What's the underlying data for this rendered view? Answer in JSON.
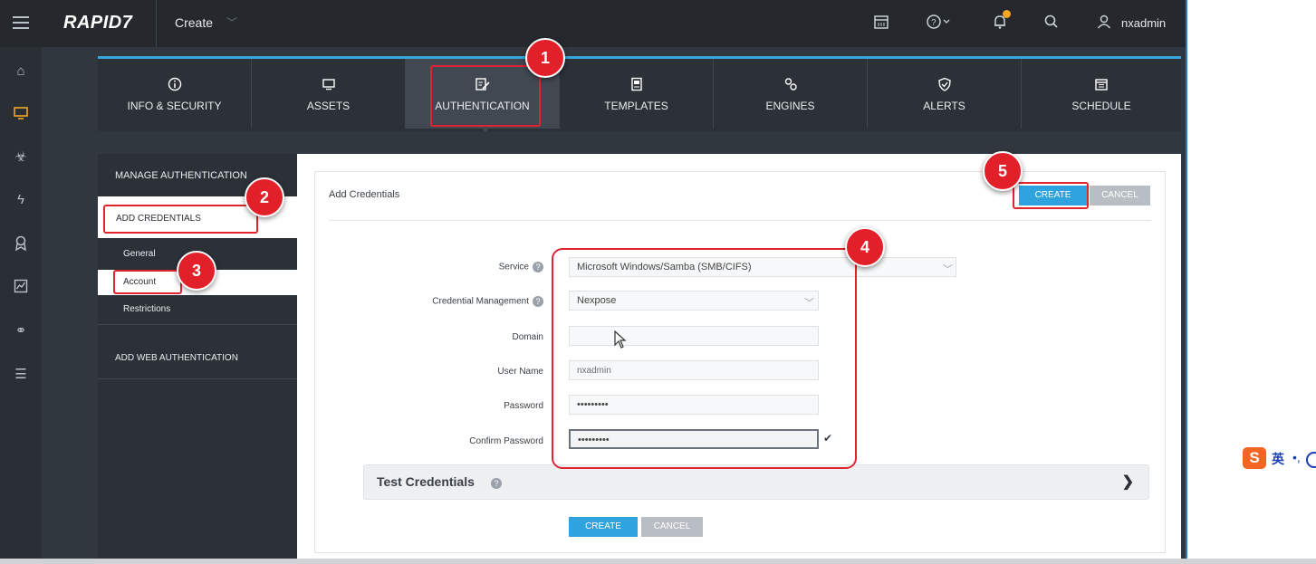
{
  "topbar": {
    "logo": "RAPID7",
    "create_menu": "Create",
    "username": "nxadmin",
    "icons": [
      "menu-icon",
      "calendar-icon",
      "help-icon",
      "bell-icon",
      "search-icon",
      "user-icon"
    ]
  },
  "leftnav": {
    "icons": [
      "home-icon",
      "monitor-icon",
      "biohazard-icon",
      "vulnerability-icon",
      "ribbon-icon",
      "chart-icon",
      "link-icon",
      "list-icon"
    ]
  },
  "tabs": [
    {
      "label": "INFO & SECURITY",
      "icon": "info-icon"
    },
    {
      "label": "ASSETS",
      "icon": "monitor-icon"
    },
    {
      "label": "AUTHENTICATION",
      "icon": "key-edit-icon"
    },
    {
      "label": "TEMPLATES",
      "icon": "template-icon"
    },
    {
      "label": "ENGINES",
      "icon": "gears-icon"
    },
    {
      "label": "ALERTS",
      "icon": "shield-icon"
    },
    {
      "label": "SCHEDULE",
      "icon": "calendar-icon"
    }
  ],
  "subpanel": {
    "manage": "MANAGE AUTHENTICATION",
    "add_credentials": "ADD CREDENTIALS",
    "items": [
      "General",
      "Account",
      "Restrictions"
    ],
    "add_web": "ADD WEB AUTHENTICATION"
  },
  "card": {
    "title": "Add Credentials",
    "create_label": "CREATE",
    "cancel_label": "CANCEL"
  },
  "form": {
    "service_label": "Service",
    "service_value": "Microsoft Windows/Samba (SMB/CIFS)",
    "cred_mgmt_label": "Credential Management",
    "cred_mgmt_value": "Nexpose",
    "domain_label": "Domain",
    "domain_value": "",
    "username_label": "User Name",
    "username_value": "nxadmin",
    "password_label": "Password",
    "password_value": "•••••••••",
    "confirm_label": "Confirm Password",
    "confirm_value": "•••••••••",
    "help_glyph": "?",
    "check_glyph": "✔"
  },
  "test_credentials": {
    "label": "Test Credentials",
    "chevron": "❯"
  },
  "markers": [
    "1",
    "2",
    "3",
    "4",
    "5"
  ],
  "ime": {
    "logo": "S",
    "char": "英",
    "punct": "•,"
  }
}
